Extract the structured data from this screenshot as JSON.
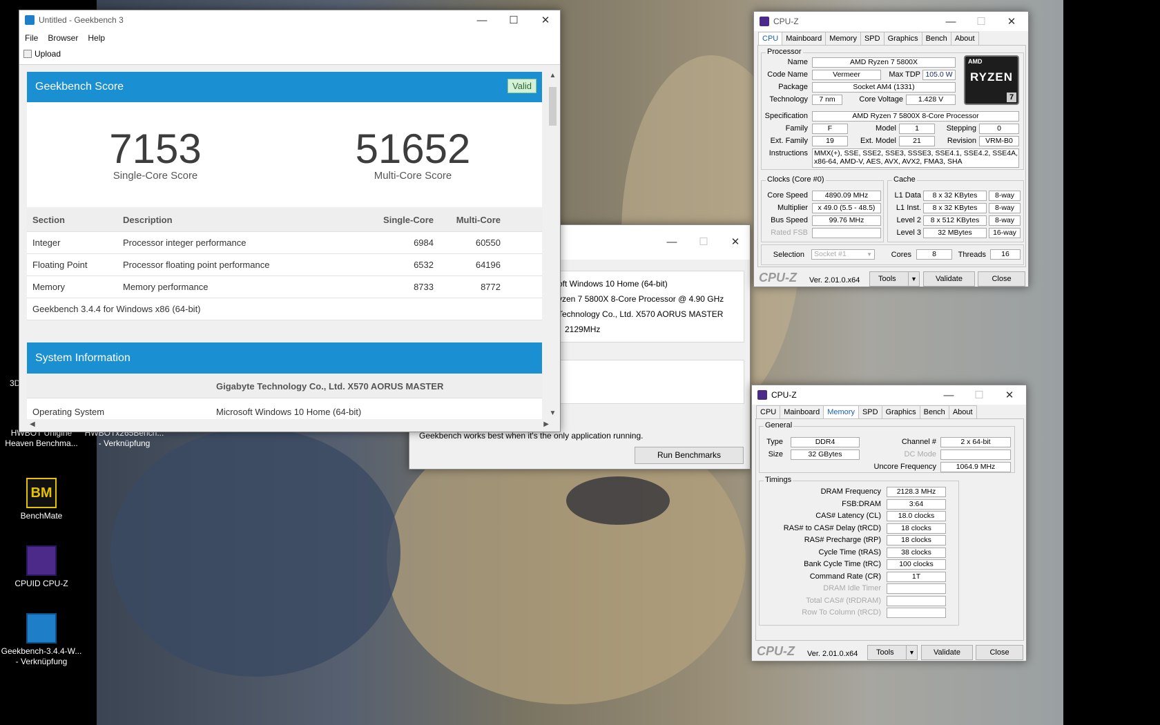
{
  "geekbench": {
    "title": "Untitled - Geekbench 3",
    "menu": [
      "File",
      "Browser",
      "Help"
    ],
    "upload_label": "Upload",
    "score_header": "Geekbench Score",
    "valid_badge": "Valid",
    "single_score": "7153",
    "single_label": "Single-Core Score",
    "multi_score": "51652",
    "multi_label": "Multi-Core Score",
    "table_headers": [
      "Section",
      "Description",
      "Single-Core",
      "Multi-Core"
    ],
    "rows": [
      [
        "Integer",
        "Processor integer performance",
        "6984",
        "60550"
      ],
      [
        "Floating Point",
        "Processor floating point performance",
        "6532",
        "64196"
      ],
      [
        "Memory",
        "Memory performance",
        "8733",
        "8772"
      ]
    ],
    "version_note": "Geekbench 3.4.4 for Windows x86 (64-bit)",
    "sysinfo_header": "System Information",
    "sysinfo_board": "Gigabyte Technology Co., Ltd. X570 AORUS MASTER",
    "os_label": "Operating System",
    "os_value": "Microsoft Windows 10 Home (64-bit)"
  },
  "launcher": {
    "lines": [
      "oft Windows 10 Home (64-bit)",
      "yzen 7 5800X 8-Core Processor @ 4.90 GHz",
      "Technology Co., Ltd. X570 AORUS MASTER",
      "2129MHz"
    ],
    "note": "Geekbench works best when it's the only application running.",
    "run_button": "Run Benchmarks"
  },
  "cpuz_cpu": {
    "title": "CPU-Z",
    "tabs": [
      "CPU",
      "Mainboard",
      "Memory",
      "SPD",
      "Graphics",
      "Bench",
      "About"
    ],
    "processor_group": "Processor",
    "name_label": "Name",
    "name": "AMD Ryzen 7 5800X",
    "codename_label": "Code Name",
    "codename": "Vermeer",
    "maxtdp_label": "Max TDP",
    "maxtdp": "105.0 W",
    "package_label": "Package",
    "package": "Socket AM4 (1331)",
    "tech_label": "Technology",
    "tech": "7 nm",
    "voltage_label": "Core Voltage",
    "voltage": "1.428 V",
    "spec_label": "Specification",
    "spec": "AMD Ryzen 7 5800X 8-Core Processor",
    "family_label": "Family",
    "family": "F",
    "model_label": "Model",
    "model": "1",
    "stepping_label": "Stepping",
    "stepping": "0",
    "extfamily_label": "Ext. Family",
    "extfamily": "19",
    "extmodel_label": "Ext. Model",
    "extmodel": "21",
    "revision_label": "Revision",
    "revision": "VRM-B0",
    "instr_label": "Instructions",
    "instr1": "MMX(+), SSE, SSE2, SSE3, SSSE3, SSE4.1, SSE4.2, SSE4A,",
    "instr2": "x86-64, AMD-V, AES, AVX, AVX2, FMA3, SHA",
    "clocks_group": "Clocks (Core #0)",
    "corespeed_label": "Core Speed",
    "corespeed": "4890.09 MHz",
    "mult_label": "Multiplier",
    "mult": "x 49.0 (5.5 - 48.5)",
    "bus_label": "Bus Speed",
    "bus": "99.76 MHz",
    "ratedfsb_label": "Rated FSB",
    "cache_group": "Cache",
    "l1d_label": "L1 Data",
    "l1d": "8 x 32 KBytes",
    "l1d_way": "8-way",
    "l1i_label": "L1 Inst.",
    "l1i": "8 x 32 KBytes",
    "l1i_way": "8-way",
    "l2_label": "Level 2",
    "l2": "8 x 512 KBytes",
    "l2_way": "8-way",
    "l3_label": "Level 3",
    "l3": "32 MBytes",
    "l3_way": "16-way",
    "selection_label": "Selection",
    "selection": "Socket #1",
    "cores_label": "Cores",
    "cores": "8",
    "threads_label": "Threads",
    "threads": "16",
    "logo_brand": "AMD",
    "logo_text": "RYZEN",
    "logo_num": "7",
    "footer_logo": "CPU-Z",
    "version": "Ver. 2.01.0.x64",
    "tools": "Tools",
    "validate": "Validate",
    "close": "Close"
  },
  "cpuz_mem": {
    "title": "CPU-Z",
    "tabs": [
      "CPU",
      "Mainboard",
      "Memory",
      "SPD",
      "Graphics",
      "Bench",
      "About"
    ],
    "general_group": "General",
    "type_label": "Type",
    "type": "DDR4",
    "size_label": "Size",
    "size": "32 GBytes",
    "channel_label": "Channel #",
    "channel": "2 x 64-bit",
    "dcmode_label": "DC Mode",
    "uncore_label": "Uncore Frequency",
    "uncore": "1064.9 MHz",
    "timings_group": "Timings",
    "timings": [
      [
        "DRAM Frequency",
        "2128.3 MHz"
      ],
      [
        "FSB:DRAM",
        "3:64"
      ],
      [
        "CAS# Latency (CL)",
        "18.0 clocks"
      ],
      [
        "RAS# to CAS# Delay (tRCD)",
        "18 clocks"
      ],
      [
        "RAS# Precharge (tRP)",
        "18 clocks"
      ],
      [
        "Cycle Time (tRAS)",
        "38 clocks"
      ],
      [
        "Bank Cycle Time (tRC)",
        "100 clocks"
      ],
      [
        "Command Rate (CR)",
        "1T"
      ],
      [
        "DRAM Idle Timer",
        ""
      ],
      [
        "Total CAS# (tRDRAM)",
        ""
      ],
      [
        "Row To Column (tRCD)",
        ""
      ]
    ],
    "footer_logo": "CPU-Z",
    "version": "Ver. 2.01.0.x64",
    "tools": "Tools",
    "validate": "Validate",
    "close": "Close"
  },
  "desktop": {
    "icons": [
      {
        "label1": "HWBOT Unigine",
        "label2": "Heaven Benchma..."
      },
      {
        "label1": "HWBOTx265Bench...",
        "label2": "- Verknüpfung"
      },
      {
        "label1": "BenchMate",
        "label2": ""
      },
      {
        "label1": "CPUID CPU-Z",
        "label2": ""
      },
      {
        "label1": "Geekbench-3.4.4-W...",
        "label2": "- Verknüpfung"
      }
    ],
    "partial_label": "3D"
  }
}
